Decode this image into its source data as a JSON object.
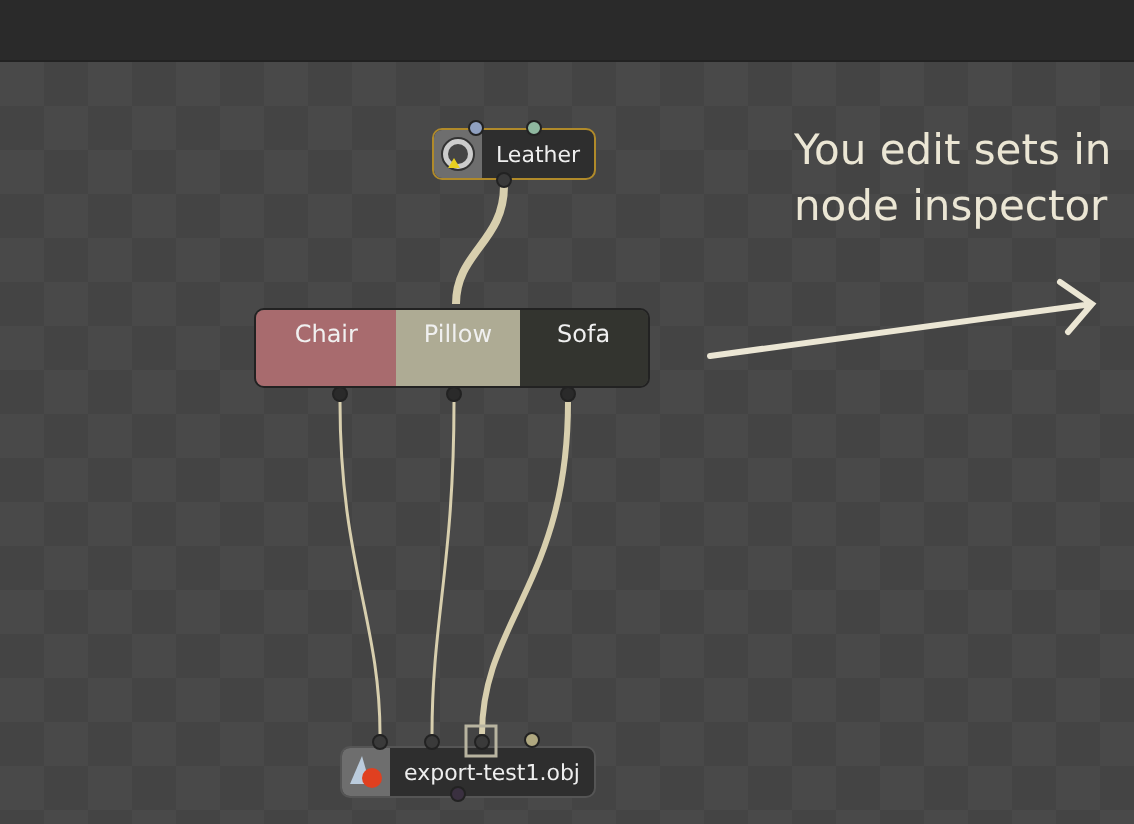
{
  "nodes": [
    {
      "kind": "material",
      "label": "Leather"
    },
    {
      "kind": "sets",
      "sets": [
        {
          "label": "Chair",
          "color": "#a86b6e"
        },
        {
          "label": "Pillow",
          "color": "#aeab94"
        },
        {
          "label": "Sofa",
          "color": "#33342f"
        }
      ]
    },
    {
      "kind": "export",
      "label": "export-test1.obj"
    }
  ],
  "annotation": "You edit sets in node inspector"
}
